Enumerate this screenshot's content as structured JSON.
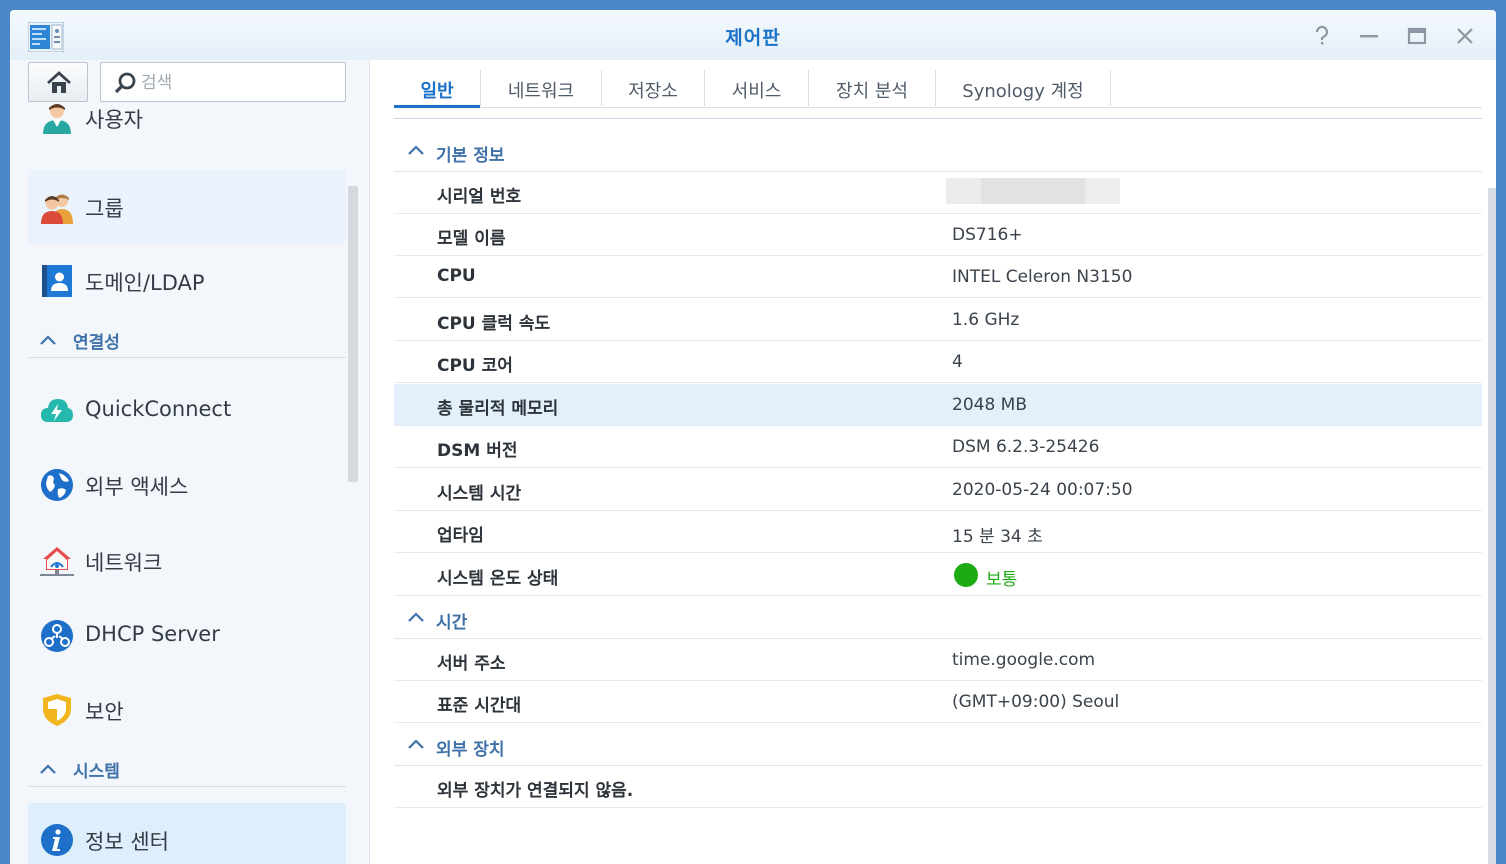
{
  "window": {
    "title": "제어판"
  },
  "search": {
    "placeholder": "검색"
  },
  "sidebar": {
    "items": [
      {
        "label": "사용자",
        "icon": "user-icon"
      },
      {
        "label": "그룹",
        "icon": "group-icon"
      },
      {
        "label": "도메인/LDAP",
        "icon": "domain-ldap-icon"
      },
      {
        "label": "QuickConnect",
        "icon": "quickconnect-icon"
      },
      {
        "label": "외부 액세스",
        "icon": "external-access-icon"
      },
      {
        "label": "네트워크",
        "icon": "network-icon"
      },
      {
        "label": "DHCP Server",
        "icon": "dhcp-server-icon"
      },
      {
        "label": "보안",
        "icon": "security-shield-icon"
      },
      {
        "label": "정보 센터",
        "icon": "info-center-icon"
      }
    ],
    "sections": [
      "연결성",
      "시스템"
    ]
  },
  "tabs": [
    "일반",
    "네트워크",
    "저장소",
    "서비스",
    "장치 분석",
    "Synology 계정"
  ],
  "basic": {
    "title": "기본 정보",
    "rows": [
      {
        "label": "시리얼 번호",
        "value": ""
      },
      {
        "label": "모델 이름",
        "value": "DS716+"
      },
      {
        "label": "CPU",
        "value": "INTEL Celeron N3150"
      },
      {
        "label": "CPU 클럭 속도",
        "value": "1.6 GHz"
      },
      {
        "label": "CPU 코어",
        "value": "4"
      },
      {
        "label": "총 물리적 메모리",
        "value": "2048 MB"
      },
      {
        "label": "DSM 버전",
        "value": "DSM 6.2.3-25426"
      },
      {
        "label": "시스템 시간",
        "value": "2020-05-24 00:07:50"
      },
      {
        "label": "업타임",
        "value": "15 분 34 초"
      },
      {
        "label": "시스템 온도 상태",
        "value": "보통"
      }
    ]
  },
  "time": {
    "title": "시간",
    "rows": [
      {
        "label": "서버 주소",
        "value": "time.google.com"
      },
      {
        "label": "표준 시간대",
        "value": "(GMT+09:00) Seoul"
      }
    ]
  },
  "external": {
    "title": "외부 장치",
    "message": "외부 장치가 연결되지 않음."
  },
  "colors": {
    "accent": "#1a72c9",
    "status_ok": "#1dab14",
    "section": "#3e72a8",
    "row_highlight": "#e3f0fb"
  }
}
